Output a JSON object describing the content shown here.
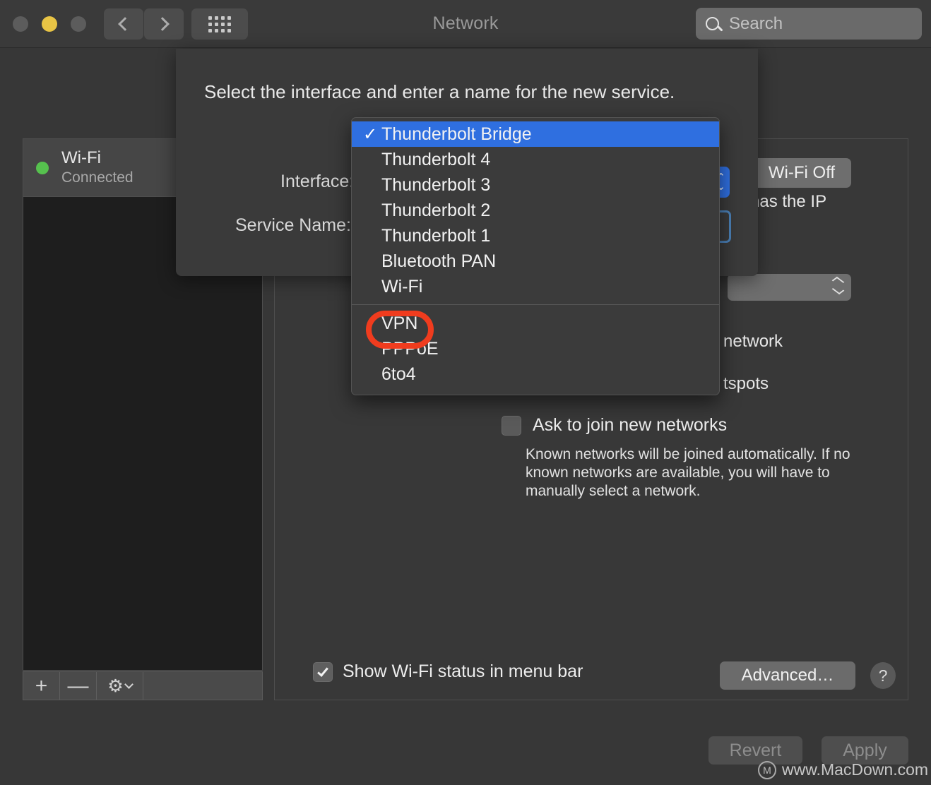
{
  "window": {
    "title": "Network",
    "traffic_lights": [
      "close",
      "minimize",
      "zoom"
    ],
    "search": {
      "placeholder": "Search",
      "icon": "search-icon"
    },
    "nav": {
      "back": "back-icon",
      "forward": "forward-icon",
      "grid": "show-all-icon"
    }
  },
  "service_list": {
    "items": [
      {
        "name": "Wi-Fi",
        "status": "Connected",
        "status_color": "#56c14e"
      }
    ],
    "toolbar": {
      "add": "+",
      "remove": "—",
      "actions_icon": "gear-icon",
      "actions_caret": "chevron-down-icon"
    }
  },
  "detail": {
    "wifi_power_button": "Wi-Fi Off",
    "status_fragment": "has the IP",
    "network_fragment": "network",
    "hotspots_fragment": "tspots",
    "ask_to_join": {
      "label": "Ask to join new networks",
      "checked": false,
      "help": "Known networks will be joined automatically. If no known networks are available, you will have to manually select a network."
    },
    "show_status": {
      "label": "Show Wi-Fi status in menu bar",
      "checked": true
    },
    "advanced_button": "Advanced…",
    "help_button": "?"
  },
  "footer": {
    "revert": "Revert",
    "apply": "Apply"
  },
  "watermark": {
    "logo": "macdown-logo-icon",
    "logo_letter": "M",
    "text": "www.MacDown.com"
  },
  "sheet": {
    "title": "Select the interface and enter a name for the new service.",
    "interface_label": "Interface:",
    "service_name_label": "Service Name:",
    "popup_glyph": "⌃⌄"
  },
  "interface_menu": {
    "selected": "Thunderbolt Bridge",
    "check_glyph": "✓",
    "groups": [
      {
        "items": [
          "Thunderbolt Bridge",
          "Thunderbolt 4",
          "Thunderbolt 3",
          "Thunderbolt 2",
          "Thunderbolt 1",
          "Bluetooth PAN",
          "Wi-Fi"
        ]
      },
      {
        "items": [
          "VPN",
          "PPPoE",
          "6to4"
        ]
      }
    ],
    "highlight_color": "#2f6fe0",
    "annotation": {
      "target": "VPN",
      "color": "#f03c1e"
    }
  }
}
